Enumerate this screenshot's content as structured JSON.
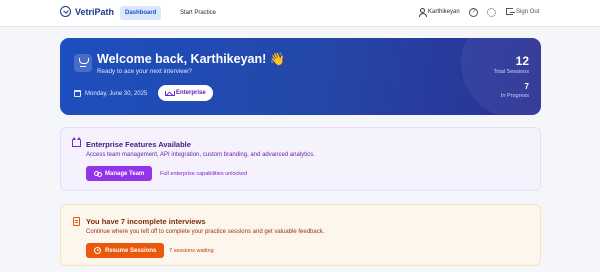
{
  "nav": {
    "brand": "VetriPath",
    "tabs": [
      {
        "label": "Dashboard",
        "active": true
      },
      {
        "label": "Start Practice",
        "active": false
      }
    ],
    "user_name": "Karthikeyan",
    "help_icon": "help-circle-icon",
    "settings_icon": "gear-icon",
    "sign_out": "Sign Out"
  },
  "hero": {
    "title": "Welcome back, Karthikeyan! 👋",
    "subtitle": "Ready to ace your next interview?",
    "date": "Monday, June 30, 2025",
    "plan_badge": "Enterprise",
    "stats": [
      {
        "value": "12",
        "label": "Total Sessions"
      },
      {
        "value": "7",
        "label": "In Progress"
      }
    ]
  },
  "enterprise_card": {
    "title": "Enterprise Features Available",
    "description": "Access team management, API integration, custom branding, and advanced analytics.",
    "button": "Manage Team",
    "note": "Full enterprise capabilities unlocked"
  },
  "incomplete_card": {
    "title": "You have 7 incomplete interviews",
    "description": "Continue where you left off to complete your practice sessions and get valuable feedback.",
    "button": "Resume Sessions",
    "note": "7 sessions waiting"
  },
  "colors": {
    "brand": "#1e3a8a",
    "hero_start": "#1e4fbf",
    "hero_end": "#2c2f93",
    "enterprise_accent": "#9333ea",
    "incomplete_accent": "#ea580c"
  }
}
